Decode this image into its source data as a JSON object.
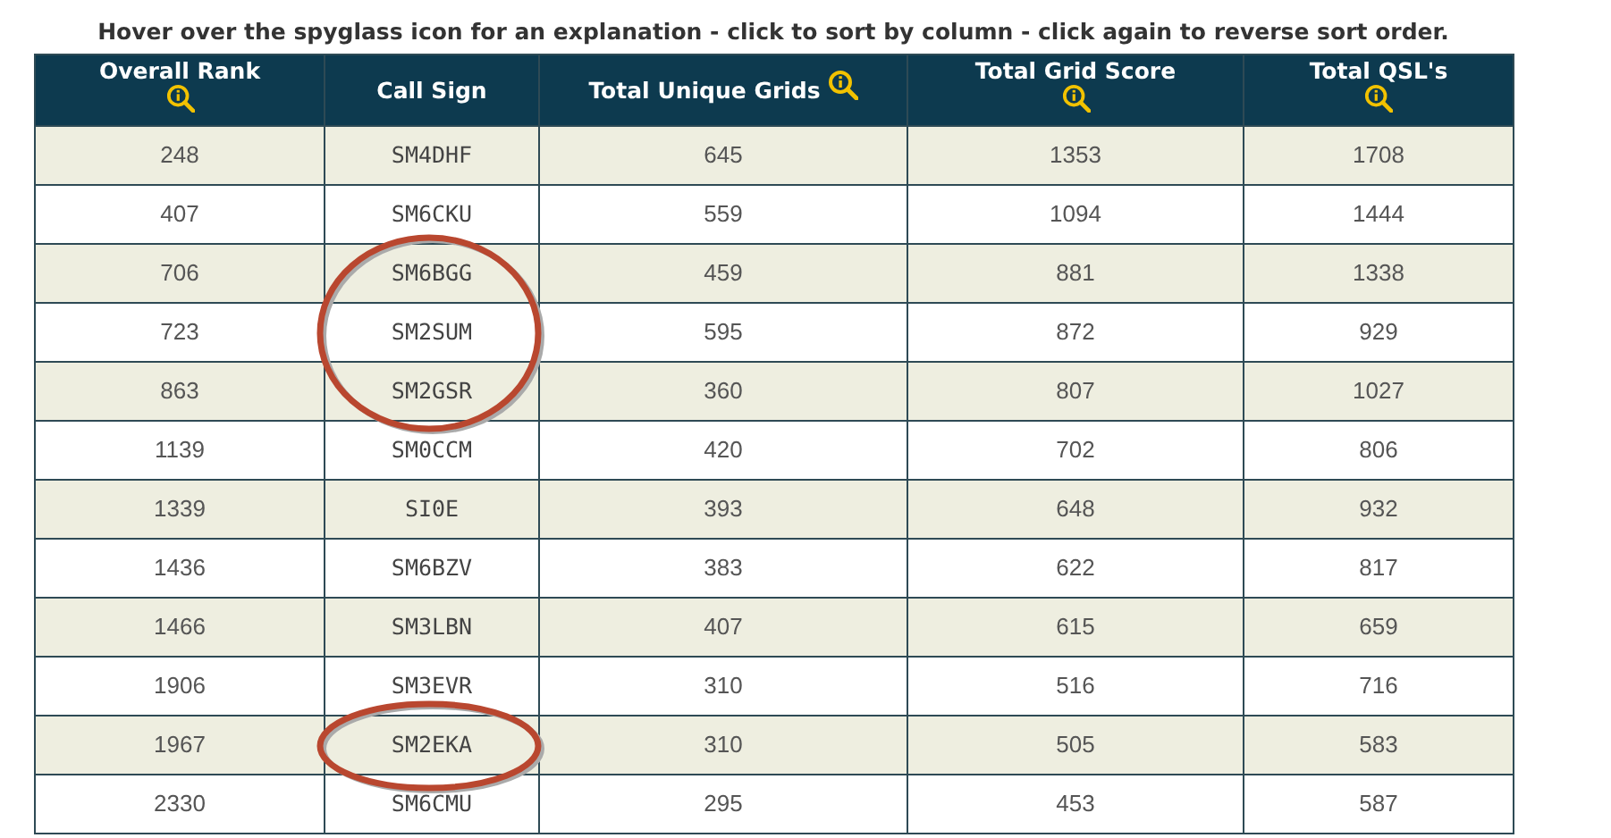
{
  "instructions": "Hover over the spyglass icon for an explanation - click to sort by column - click again to reverse sort order.",
  "table": {
    "columns": [
      {
        "label": "Overall Rank",
        "kind": "stacked"
      },
      {
        "label": "Call Sign",
        "kind": "plain"
      },
      {
        "label": "Total Unique Grids",
        "kind": "inline"
      },
      {
        "label": "Total Grid Score",
        "kind": "stacked"
      },
      {
        "label": "Total QSL's",
        "kind": "stacked"
      }
    ],
    "rows": [
      {
        "cells": [
          "248",
          "SM4DHF",
          "645",
          "1353",
          "1708"
        ],
        "circled": false
      },
      {
        "cells": [
          "407",
          "SM6CKU",
          "559",
          "1094",
          "1444"
        ],
        "circled": false
      },
      {
        "cells": [
          "706",
          "SM6BGG",
          "459",
          "881",
          "1338"
        ],
        "circled": true
      },
      {
        "cells": [
          "723",
          "SM2SUM",
          "595",
          "872",
          "929"
        ],
        "circled": true
      },
      {
        "cells": [
          "863",
          "SM2GSR",
          "360",
          "807",
          "1027"
        ],
        "circled": true
      },
      {
        "cells": [
          "1139",
          "SM0CCM",
          "420",
          "702",
          "806"
        ],
        "circled": false
      },
      {
        "cells": [
          "1339",
          "SI0E",
          "393",
          "648",
          "932"
        ],
        "circled": false
      },
      {
        "cells": [
          "1436",
          "SM6BZV",
          "383",
          "622",
          "817"
        ],
        "circled": false
      },
      {
        "cells": [
          "1466",
          "SM3LBN",
          "407",
          "615",
          "659"
        ],
        "circled": false
      },
      {
        "cells": [
          "1906",
          "SM3EVR",
          "310",
          "516",
          "716"
        ],
        "circled": false
      },
      {
        "cells": [
          "1967",
          "SM2EKA",
          "310",
          "505",
          "583"
        ],
        "circled": true
      },
      {
        "cells": [
          "2330",
          "SM6CMU",
          "295",
          "453",
          "587"
        ],
        "circled": false
      }
    ]
  }
}
